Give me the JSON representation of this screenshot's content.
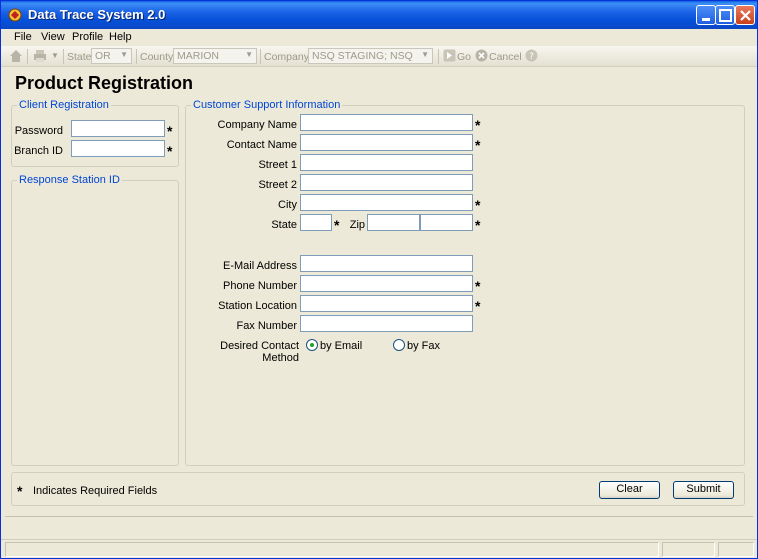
{
  "window": {
    "title": "Data Trace System 2.0"
  },
  "menu": [
    {
      "label": "File"
    },
    {
      "label": "View"
    },
    {
      "label": "Profile"
    },
    {
      "label": "Help"
    }
  ],
  "toolbar": {
    "state_label": "State",
    "state_value": "OR",
    "county_label": "County",
    "county_value": "MARION",
    "company_label": "Company",
    "company_value": "NSQ STAGING; NSQ",
    "go_label": "Go",
    "cancel_label": "Cancel"
  },
  "page": {
    "title": "Product Registration"
  },
  "client_registration": {
    "title": "Client Registration",
    "password_label": "Password",
    "password_value": "",
    "branch_label": "Branch ID",
    "branch_value": ""
  },
  "response_station": {
    "title": "Response Station ID"
  },
  "support": {
    "title": "Customer Support Information",
    "company_name": "Company Name",
    "contact_name": "Contact Name",
    "street1": "Street 1",
    "street2": "Street 2",
    "city": "City",
    "state": "State",
    "zip": "Zip",
    "email": "E-Mail Address",
    "phone": "Phone Number",
    "station_location": "Station Location",
    "fax": "Fax Number",
    "contact_method_label": "Desired Contact Method",
    "by_email": "by Email",
    "by_fax": "by Fax",
    "selected_method": "by Email"
  },
  "footer": {
    "required_star": "*",
    "required_note": "Indicates Required Fields",
    "clear": "Clear",
    "submit": "Submit"
  },
  "required_marker": "*",
  "colors": {
    "group_title": "#0046d5",
    "titlebar": "#0550d8",
    "radio_selected": "#21a121"
  }
}
